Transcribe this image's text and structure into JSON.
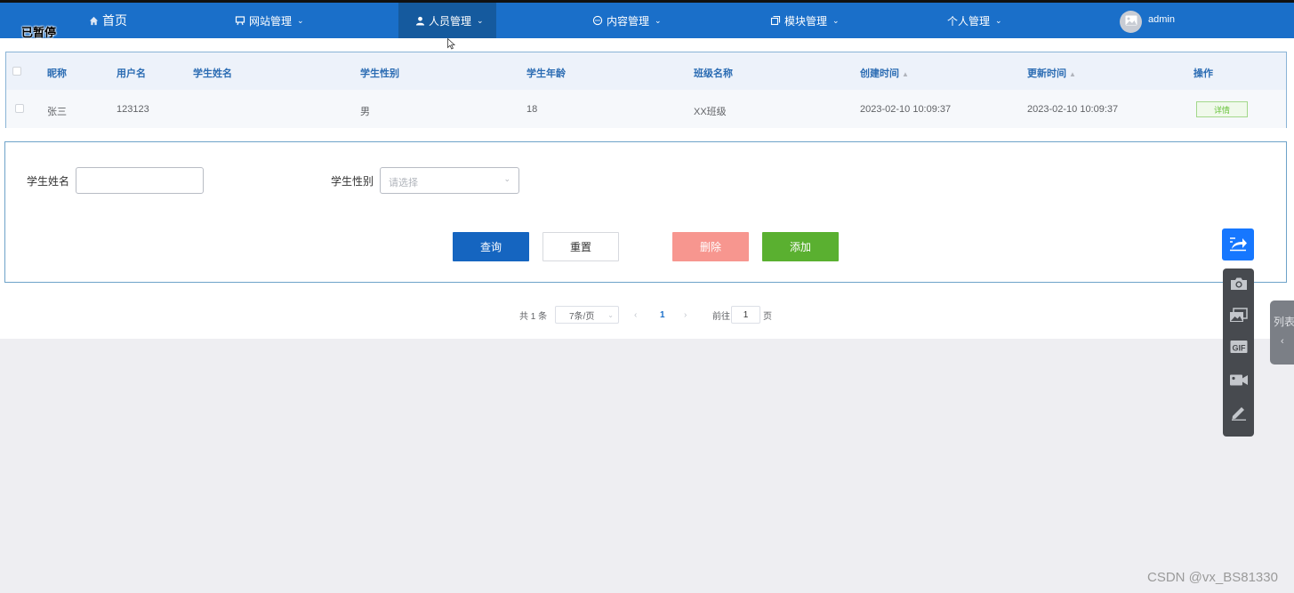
{
  "overlay": {
    "paused_label": "已暂停"
  },
  "nav": {
    "items": [
      {
        "label": "首页",
        "icon": "home-icon"
      },
      {
        "label": "网站管理",
        "icon": "easel-icon"
      },
      {
        "label": "人员管理",
        "icon": "user-icon"
      },
      {
        "label": "内容管理",
        "icon": "chat-bubble-icon"
      },
      {
        "label": "模块管理",
        "icon": "copy-icon"
      },
      {
        "label": "个人管理",
        "icon": ""
      }
    ],
    "active": "人员管理",
    "user": {
      "name": "admin",
      "icon": "avatar-image-icon"
    }
  },
  "table": {
    "columns": [
      "昵称",
      "用户名",
      "学生姓名",
      "学生性别",
      "学生年龄",
      "班级名称",
      "创建时间",
      "更新时间",
      "操作"
    ],
    "rows": [
      {
        "nickname": "张三",
        "username": "123123",
        "student_name": "",
        "gender": "男",
        "age": "18",
        "class_name": "XX班级",
        "created": "2023-02-10 10:09:37",
        "updated": "2023-02-10 10:09:37",
        "action": "详情"
      }
    ]
  },
  "search": {
    "name_label": "学生姓名",
    "name_value": "",
    "gender_label": "学生性别",
    "gender_placeholder": "请选择",
    "query_label": "查询",
    "reset_label": "重置",
    "delete_label": "删除",
    "add_label": "添加"
  },
  "pagination": {
    "total_text": "共 1 条",
    "page_size": "7条/页",
    "current_page": "1",
    "goto_prefix": "前往",
    "goto_value": "1",
    "goto_suffix": "页"
  },
  "side": {
    "list_tab_label": "列表",
    "tools": [
      "camera-icon",
      "images-icon",
      "gif-icon",
      "video-camera-icon",
      "pen-icon"
    ],
    "share_icon": "share-icon"
  },
  "watermark": "CSDN @vx_BS81330",
  "colors": {
    "nav_bg": "#1a6fc9",
    "nav_active": "#155a9e",
    "primary": "#1565c0",
    "danger": "#f7968f",
    "success": "#5ab030",
    "header_text": "#2b6cb3"
  }
}
